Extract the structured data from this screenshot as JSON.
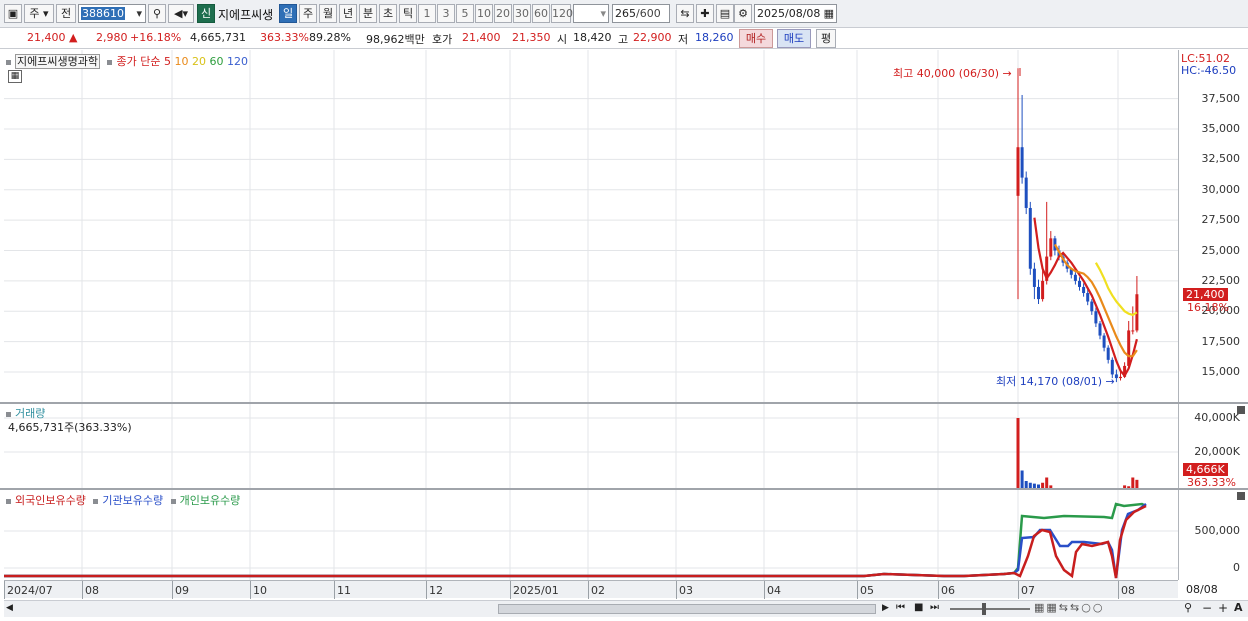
{
  "toolbar": {
    "period_toggle": "주",
    "prev_label": "전",
    "code": "388610",
    "new_badge": "신",
    "stock_name": "지에프씨생",
    "periods": [
      "일",
      "주",
      "월",
      "년",
      "분",
      "초",
      "틱"
    ],
    "active_period": "일",
    "intervals": [
      "1",
      "3",
      "5",
      "10",
      "20",
      "30",
      "60",
      "120"
    ],
    "count_current": "265",
    "count_total": "/600",
    "date": "2025/08/08"
  },
  "quote": {
    "price": "21,400",
    "change": "2,980",
    "change_pct": "+16.18%",
    "volume": "4,665,731",
    "vol_ratio": "363.33%",
    "rate": "89.28%",
    "amount": "98,962백만",
    "hoga_label": "호가",
    "ask": "21,400",
    "bid": "21,350",
    "open_label": "시",
    "open": "18,420",
    "high_label": "고",
    "high": "22,900",
    "low_label": "저",
    "low": "18,260",
    "buy_label": "매수",
    "sell_label": "매도",
    "avg_label": "평"
  },
  "price_panel": {
    "stock_label": "지에프씨생명과학",
    "ma_label": "종가 단순",
    "ma_periods": [
      "5",
      "10",
      "20",
      "60",
      "120"
    ],
    "ma_colors": [
      "#d21e1e",
      "#e98a1a",
      "#e8d41a",
      "#2e9e3e",
      "#3a5fcf"
    ],
    "lc": "LC:51.02",
    "hc": "HC:-46.50",
    "high_note": "최고 40,000 (06/30)",
    "low_note": "최저 14,170 (08/01)",
    "last_price_tag": "21,400",
    "last_pct_tag": "16.18%",
    "y_ticks": [
      "37,500",
      "35,000",
      "32,500",
      "30,000",
      "27,500",
      "25,000",
      "22,500",
      "20,000",
      "17,500",
      "15,000"
    ]
  },
  "volume_panel": {
    "label": "거래량",
    "value": "4,665,731주(363.33%)",
    "y_ticks": [
      "40,000K",
      "20,000K"
    ],
    "last_tag": "4,666K",
    "last_pct": "363.33%"
  },
  "holding_panel": {
    "legend": [
      {
        "name": "외국인보유수량",
        "color": "#c81e1e"
      },
      {
        "name": "기관보유수량",
        "color": "#2a4fc8"
      },
      {
        "name": "개인보유수량",
        "color": "#2a9a4a"
      }
    ],
    "y_ticks": [
      "500,000",
      "0"
    ]
  },
  "x_axis": {
    "labels": [
      "2024/07",
      "08",
      "09",
      "10",
      "11",
      "12",
      "2025/01",
      "02",
      "03",
      "04",
      "05",
      "06",
      "07",
      "08"
    ],
    "right_label": "08/08"
  },
  "chart_data": {
    "type": "line",
    "candles": {
      "x": [
        "06/30",
        "07/01",
        "07/02",
        "07/03",
        "07/04",
        "07/07",
        "07/08",
        "07/09",
        "07/10",
        "07/11",
        "07/14",
        "07/15",
        "07/16",
        "07/17",
        "07/18",
        "07/21",
        "07/22",
        "07/23",
        "07/24",
        "07/25",
        "07/28",
        "07/29",
        "07/30",
        "07/31",
        "08/01",
        "08/04",
        "08/05",
        "08/06",
        "08/07",
        "08/08"
      ],
      "open": [
        29500,
        33500,
        31000,
        28500,
        23500,
        22000,
        21000,
        22500,
        24500,
        26000,
        25000,
        24500,
        24000,
        23500,
        23000,
        22500,
        22000,
        21500,
        20800,
        20000,
        19000,
        18000,
        17000,
        16000,
        14800,
        14500,
        14600,
        15500,
        18420,
        18420
      ],
      "close": [
        33500,
        31000,
        28500,
        23500,
        22000,
        21000,
        22500,
        24500,
        26000,
        25000,
        24500,
        24000,
        23500,
        23000,
        22500,
        22000,
        21500,
        20800,
        20000,
        19000,
        18000,
        17000,
        16000,
        14800,
        14500,
        14600,
        15500,
        18420,
        18420,
        21400
      ],
      "high": [
        40000,
        37800,
        31500,
        29000,
        24000,
        22600,
        23500,
        29000,
        26600,
        26200,
        25400,
        24800,
        24200,
        23600,
        23200,
        22800,
        22300,
        21800,
        21000,
        20300,
        19200,
        18200,
        17200,
        16200,
        15200,
        15000,
        15800,
        19200,
        20400,
        22900
      ],
      "low": [
        21000,
        30500,
        28000,
        23000,
        21000,
        20600,
        20800,
        22200,
        24200,
        24600,
        24200,
        23700,
        23200,
        22700,
        22200,
        21700,
        21200,
        20500,
        19700,
        18700,
        17700,
        16700,
        15700,
        14500,
        14170,
        14300,
        14500,
        15300,
        18100,
        18260
      ]
    },
    "series": [
      {
        "name": "5",
        "x": [
          "07/04",
          "07/07",
          "07/08",
          "07/09",
          "07/10",
          "07/11",
          "07/14",
          "07/15",
          "07/16",
          "07/17",
          "07/18",
          "07/21",
          "07/22",
          "07/23",
          "07/24",
          "07/25",
          "07/28",
          "07/29",
          "07/30",
          "07/31",
          "08/01",
          "08/04",
          "08/05",
          "08/06",
          "08/07",
          "08/08"
        ],
        "values": [
          27700,
          25200,
          23500,
          22700,
          23200,
          23800,
          24500,
          24800,
          24400,
          24000,
          23500,
          23000,
          22500,
          21900,
          21300,
          20500,
          19700,
          18800,
          17900,
          16900,
          15900,
          15100,
          14700,
          15300,
          16400,
          17700
        ]
      },
      {
        "name": "10",
        "x": [
          "07/11",
          "07/14",
          "07/15",
          "07/16",
          "07/17",
          "07/18",
          "07/21",
          "07/22",
          "07/23",
          "07/24",
          "07/25",
          "07/28",
          "07/29",
          "07/30",
          "07/31",
          "08/01",
          "08/04",
          "08/05",
          "08/06",
          "08/07",
          "08/08"
        ],
        "values": [
          25500,
          24900,
          24300,
          23800,
          23500,
          23300,
          23200,
          23100,
          22800,
          22400,
          21800,
          21100,
          20300,
          19500,
          18700,
          17900,
          17200,
          16600,
          16300,
          16300,
          16800
        ]
      },
      {
        "name": "20",
        "x": [
          "07/25",
          "07/28",
          "07/29",
          "07/30",
          "07/31",
          "08/01",
          "08/04",
          "08/05",
          "08/06",
          "08/07",
          "08/08"
        ],
        "values": [
          24000,
          23400,
          22700,
          21900,
          21300,
          20800,
          20400,
          20000,
          19800,
          19700,
          19900
        ]
      }
    ],
    "volume": {
      "x": [
        "06/30",
        "07/01",
        "07/02",
        "07/03",
        "07/04",
        "07/07",
        "07/08",
        "07/09",
        "07/10",
        "08/05",
        "08/06",
        "08/07",
        "08/08"
      ],
      "values": [
        40000000,
        10000000,
        4000000,
        3000000,
        2500000,
        2000000,
        3000000,
        6000000,
        1500000,
        1500000,
        1000000,
        6000000,
        4665731
      ]
    },
    "holdings": [
      {
        "name": "외국인보유수량",
        "values_note": "near 0 until 06/30, then ~500,000 range, ends ~800,000"
      },
      {
        "name": "기관보유수량",
        "values_note": "near 0 until 06/30, then ~400,000, ends ~850,000"
      },
      {
        "name": "개인보유수량",
        "values_note": "near 0 until 06/30, then ~750,000–800,000, ends ~820,000"
      }
    ],
    "ylim": [
      14000,
      41000
    ]
  }
}
